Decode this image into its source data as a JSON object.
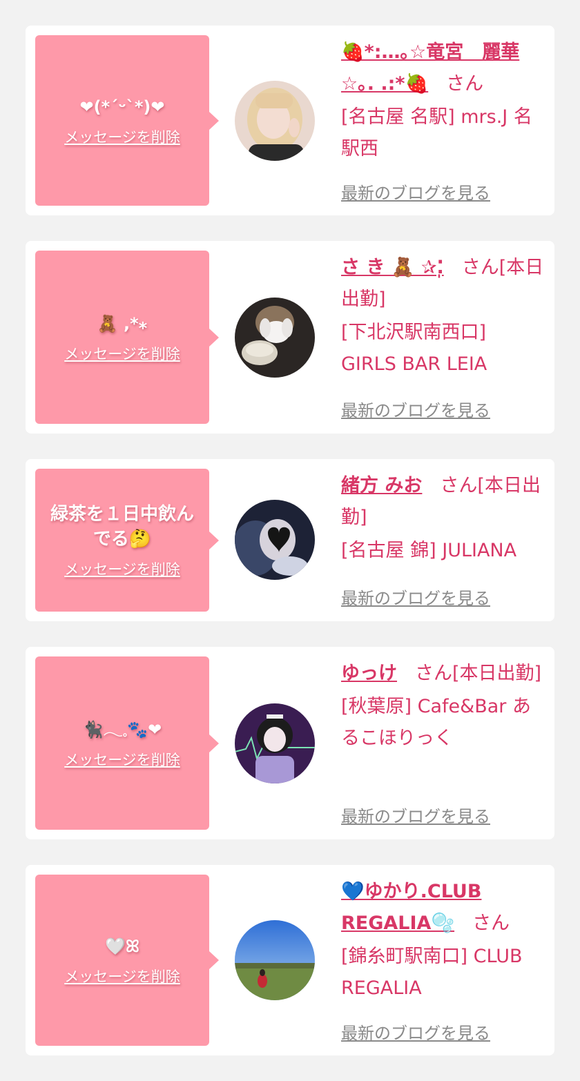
{
  "delete_label": "メッセージを削除",
  "blog_label": "最新のブログを見る",
  "san_suffix": "さん",
  "colors": {
    "bubble": "#fe99a9",
    "accent": "#d83766",
    "blog_link": "#8a8a8a",
    "card": "#ffffff",
    "background": "#f2f2f2"
  },
  "entries": [
    {
      "message": "❤(*´ᵕ`*)❤",
      "name": "🍓*:…｡☆竜宮　麗華☆｡. .:*🍓",
      "san": "さん",
      "shop": "[名古屋 名駅] mrs.J 名駅西",
      "avatar": "avatar-blonde-peace-sign"
    },
    {
      "message": "🧸 ,*⁎",
      "name": "さ き 🧸 ✰⁚̩",
      "san": "さん[本日出勤]",
      "shop": "[下北沢駅南西口] GIRLS BAR LEIA",
      "avatar": "avatar-cake-plush"
    },
    {
      "message": "緑茶を１日中飲んでる🤔",
      "name": "緒方 みお",
      "san": "さん[本日出勤]",
      "shop": "[名古屋 錦] JULIANA",
      "avatar": "avatar-heart-face"
    },
    {
      "message": "🐈‍⬛𓂃𓈒🐾❤",
      "name": "ゆっけ",
      "san": "さん[本日出勤]",
      "shop": "[秋葉原] Cafe&Bar あるこほりっく",
      "avatar": "avatar-purple-costume"
    },
    {
      "message": "🤍ꕤ",
      "name": "💙ゆかり.CLUB REGALIA🫧",
      "san": "さん",
      "shop": "[錦糸町駅南口] CLUB REGALIA",
      "avatar": "avatar-park-sky"
    }
  ]
}
